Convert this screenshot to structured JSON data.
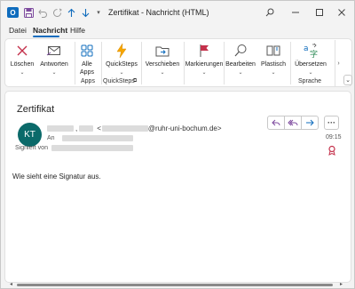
{
  "window": {
    "title": "Zertifikat  -  Nachricht (HTML)",
    "app_icon_letter": "O"
  },
  "menu": {
    "tabs": [
      "Datei",
      "Nachricht",
      "Hilfe"
    ],
    "active_tab": "Nachricht"
  },
  "ribbon": {
    "buttons": {
      "loeschen": "Löschen",
      "antworten": "Antworten",
      "alle_apps_1": "Alle",
      "alle_apps_2": "Apps",
      "quicksteps": "QuickSteps",
      "verschieben": "Verschieben",
      "markierungen": "Markierungen",
      "bearbeiten": "Bearbeiten",
      "plastisch": "Plastisch",
      "uebersetzen": "Übersetzen"
    },
    "groups": {
      "apps": "Apps",
      "quicksteps": "QuickSteps",
      "sprache": "Sprache"
    }
  },
  "message": {
    "subject": "Zertifikat",
    "avatar_initials": "KT",
    "sender_email_suffix": "@ruhr-uni-bochum.de>",
    "sender_open_bracket": "<",
    "sender_comma": ",",
    "to_label": "An",
    "signed_label": "Signiert von",
    "time": "09:15",
    "body": "Wie sieht eine Signatur aus."
  },
  "colors": {
    "accent": "#0f6cbd",
    "avatar": "#0b6a6a",
    "reply_action": "#7d4a9e",
    "cert_badge": "#c4314b"
  }
}
